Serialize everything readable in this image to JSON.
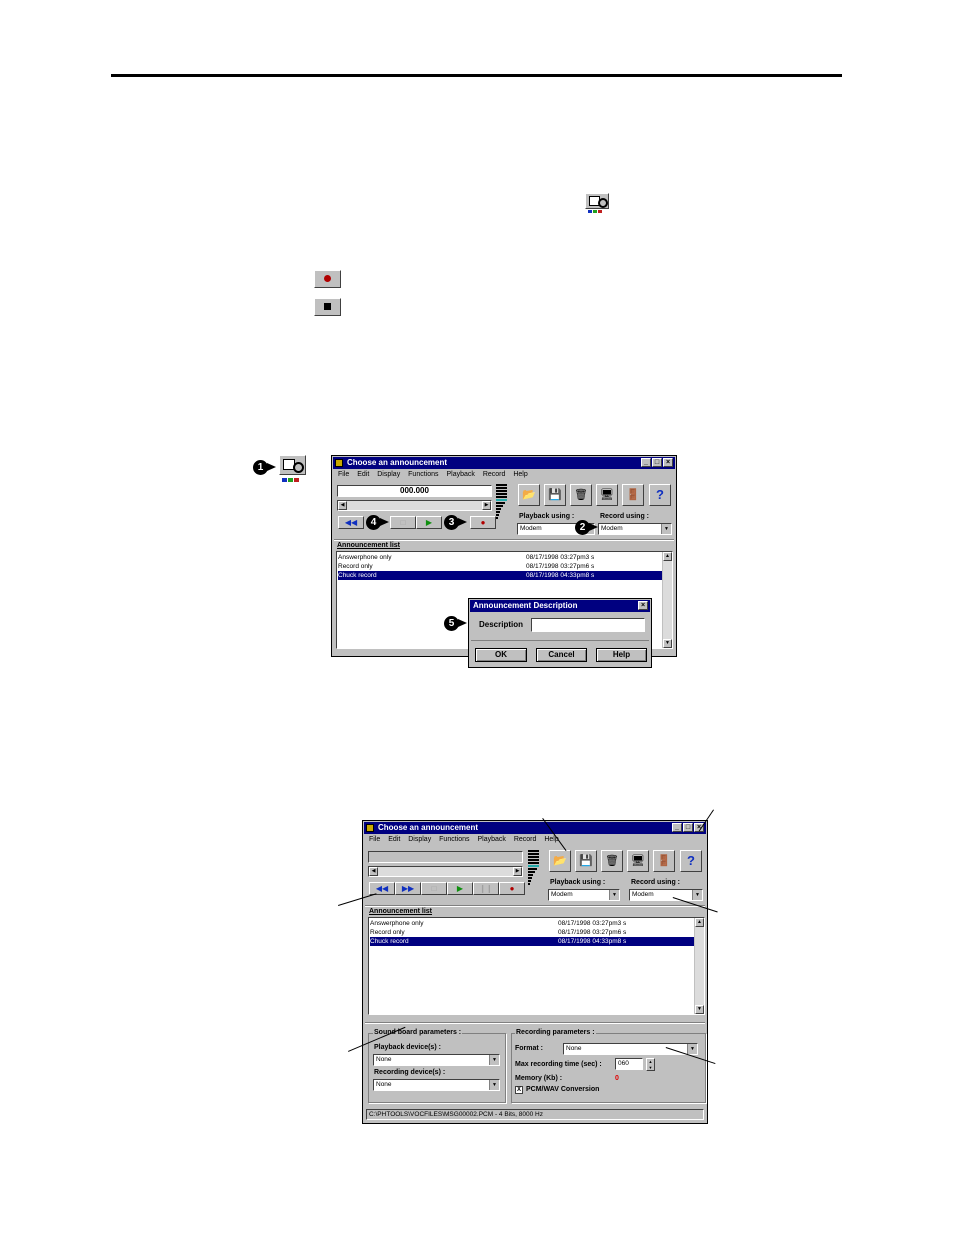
{
  "main_window": {
    "title": "Choose an announcement",
    "menu": [
      "File",
      "Edit",
      "Display",
      "Functions",
      "Playback",
      "Record",
      "Help"
    ],
    "counter": "000.000",
    "playback_label": "Playback using :",
    "playback_value": "Modem",
    "record_label": "Record using :",
    "record_value": "Modem",
    "list_header": "Announcement list",
    "rows": [
      {
        "name": "Answerphone only",
        "date": "08/17/1998 03:27pm3 s"
      },
      {
        "name": "Record only",
        "date": "08/17/1998 03:27pm6 s"
      },
      {
        "name": "Chuck record",
        "date": "08/17/1998 04:33pm8 s"
      }
    ]
  },
  "dialog": {
    "title": "Announcement Description",
    "description_label": "Description",
    "ok": "OK",
    "cancel": "Cancel",
    "help": "Help"
  },
  "badges": {
    "b1": "1",
    "b2": "2",
    "b3": "3",
    "b4": "4",
    "b5": "5"
  },
  "second_window": {
    "title": "Choose an announcement",
    "playback_label": "Playback using :",
    "playback_value": "Modem",
    "record_label": "Record using :",
    "record_value": "Modem",
    "list_header": "Announcement list",
    "sound_board_label": "Sound board parameters :",
    "playback_devices_label": "Playback device(s) :",
    "playback_devices_value": "None",
    "recording_devices_label": "Recording device(s) :",
    "recording_devices_value": "None",
    "recording_params_label": "Recording parameters :",
    "format_label": "Format :",
    "format_value": "None",
    "max_time_label": "Max recording time (sec) :",
    "max_time_value": "060",
    "memory_label": "Memory (Kb) :",
    "memory_value": "0",
    "pcm_label": "PCM/WAV Conversion",
    "pcm_check": "X",
    "status": "C:\\PHTOOLS\\VOCFILES\\MSG00002.PCM - 4 Bits, 8000 Hz"
  }
}
